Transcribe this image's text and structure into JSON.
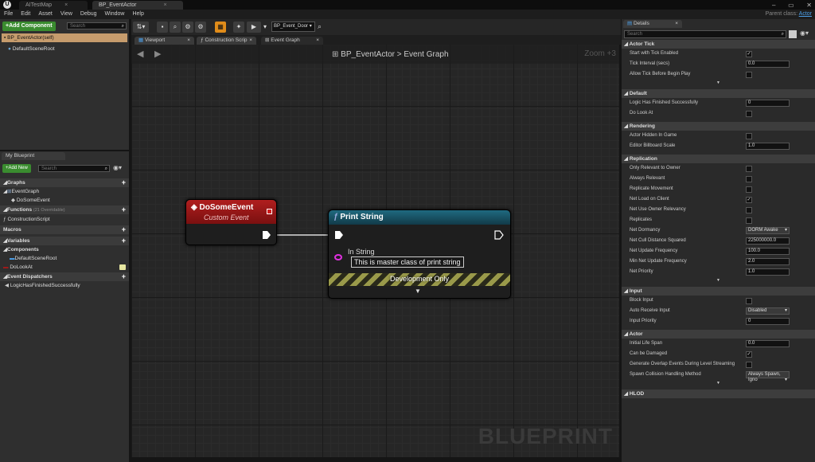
{
  "titlebar": {
    "tabs": [
      "AITestMap",
      "BP_EventActor"
    ]
  },
  "menu": [
    "File",
    "Edit",
    "Asset",
    "View",
    "Debug",
    "Window",
    "Help"
  ],
  "parent_class": {
    "label": "Parent class:",
    "value": "Actor"
  },
  "components": {
    "add_button": "+Add Component",
    "search_placeholder": "Search",
    "items": [
      "BP_EventActor(self)",
      "DefaultSceneRoot"
    ]
  },
  "my_blueprint": {
    "tab": "My Blueprint",
    "add_new": "+Add New",
    "search_placeholder": "Search",
    "graphs_label": "Graphs",
    "graph_items": [
      "EventGraph",
      "DoSomeEvent"
    ],
    "functions_label": "Functions",
    "functions_note": "(21 Overridable)",
    "function_items": [
      "ConstructionScript"
    ],
    "macros_label": "Macros",
    "variables_label": "Variables",
    "components_label": "Components",
    "component_items": [
      "DefaultSceneRoot",
      "DoLookAt"
    ],
    "dispatchers_label": "Event Dispatchers",
    "dispatcher_items": [
      "LogicHasFinishedSuccessfully"
    ]
  },
  "toolbar": {
    "debug_object": "BP_Event_Door"
  },
  "graph_tabs": [
    "Viewport",
    "Construction Scrip",
    "Event Graph"
  ],
  "graph": {
    "breadcrumb_bp": "BP_EventActor",
    "breadcrumb_sep": ">",
    "breadcrumb_graph": "Event Graph",
    "zoom": "Zoom +3",
    "watermark": "BLUEPRINT"
  },
  "event_node": {
    "title": "DoSomeEvent",
    "subtitle": "Custom Event"
  },
  "print_node": {
    "title": "Print String",
    "pin_label": "In String",
    "pin_value": "This is master class of print string",
    "dev_only": "Development Only"
  },
  "details": {
    "tab": "Details",
    "search_placeholder": "Search",
    "sections": [
      {
        "title": "Actor Tick",
        "rows": [
          {
            "label": "Start with Tick Enabled",
            "kind": "check",
            "value": true
          },
          {
            "label": "Tick Interval (secs)",
            "kind": "num",
            "value": "0.0"
          },
          {
            "label": "Allow Tick Before Begin Play",
            "kind": "check",
            "value": false
          }
        ],
        "expander": true
      },
      {
        "title": "Default",
        "rows": [
          {
            "label": "Logic Has Finished Successfully",
            "kind": "num",
            "value": "0"
          },
          {
            "label": "Do Look At",
            "kind": "check",
            "value": false
          }
        ]
      },
      {
        "title": "Rendering",
        "rows": [
          {
            "label": "Actor Hidden In Game",
            "kind": "check",
            "value": false
          },
          {
            "label": "Editor Billboard Scale",
            "kind": "num",
            "value": "1.0"
          }
        ]
      },
      {
        "title": "Replication",
        "rows": [
          {
            "label": "Only Relevant to Owner",
            "kind": "check",
            "value": false
          },
          {
            "label": "Always Relevant",
            "kind": "check",
            "value": false
          },
          {
            "label": "Replicate Movement",
            "kind": "check",
            "value": false
          },
          {
            "label": "Net Load on Client",
            "kind": "check",
            "value": true
          },
          {
            "label": "Net Use Owner Relevancy",
            "kind": "check",
            "value": false
          },
          {
            "label": "Replicates",
            "kind": "check",
            "value": false
          },
          {
            "label": "Net Dormancy",
            "kind": "dd",
            "value": "DORM Awake"
          },
          {
            "label": "Net Cull Distance Squared",
            "kind": "num",
            "value": "225000000.0"
          },
          {
            "label": "Net Update Frequency",
            "kind": "num",
            "value": "100.0"
          },
          {
            "label": "Min Net Update Frequency",
            "kind": "num",
            "value": "2.0"
          },
          {
            "label": "Net Priority",
            "kind": "num",
            "value": "1.0"
          }
        ],
        "expander": true
      },
      {
        "title": "Input",
        "rows": [
          {
            "label": "Block Input",
            "kind": "check",
            "value": false
          },
          {
            "label": "Auto Receive Input",
            "kind": "dd",
            "value": "Disabled"
          },
          {
            "label": "Input Priority",
            "kind": "num",
            "value": "0"
          }
        ]
      },
      {
        "title": "Actor",
        "rows": [
          {
            "label": "Initial Life Span",
            "kind": "num",
            "value": "0.0"
          },
          {
            "label": "Can be Damaged",
            "kind": "check",
            "value": true
          },
          {
            "label": "Generate Overlap Events During Level Streaming",
            "kind": "check",
            "value": false
          },
          {
            "label": "Spawn Collision Handling Method",
            "kind": "dd",
            "value": "Always Spawn, Igno"
          }
        ],
        "expander": true
      },
      {
        "title": "HLOD",
        "rows": []
      }
    ]
  },
  "colors": {
    "accent_green": "#3a8c2f",
    "event_red": "#a11a1a",
    "function_blue": "#17556b",
    "selected_tan": "#c69c6d"
  }
}
